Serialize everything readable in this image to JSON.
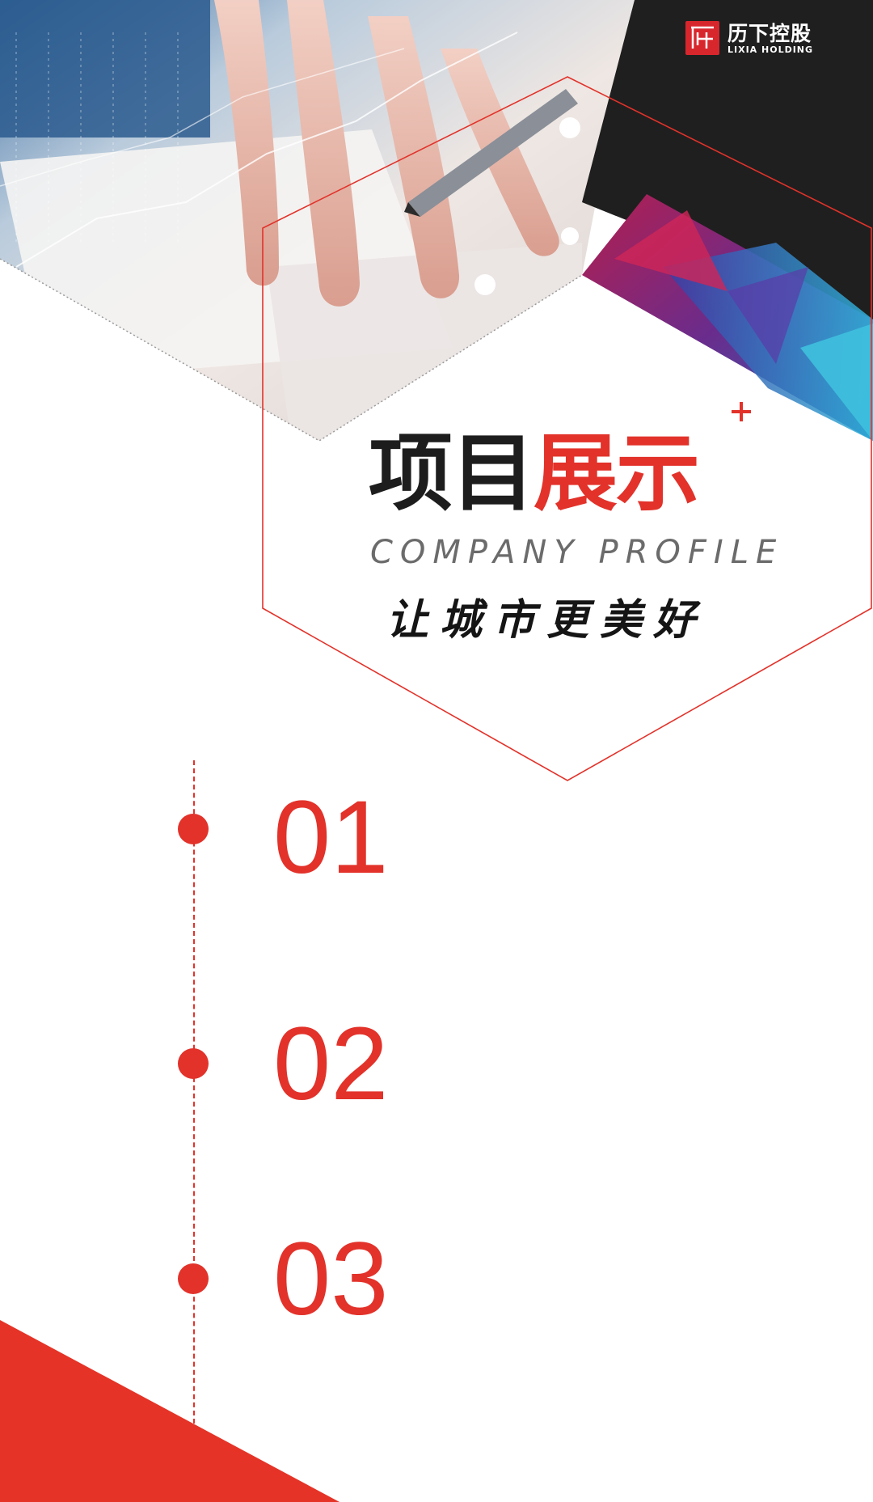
{
  "brand": {
    "name_cn": "历下控股",
    "name_en": "LIXIA HOLDING",
    "logo_icon": "lixia-logo-icon",
    "accent": "#e2322a",
    "dark": "#1d1d1d"
  },
  "hero": {
    "photo": "hand-with-pen-over-documents",
    "title_part1": "项目",
    "title_part2": "展示",
    "subtitle_en": "COMPANY PROFILE",
    "slogan": "让城市更美好",
    "plus_icon": "plus-icon"
  },
  "timeline": {
    "items": [
      {
        "label": "01"
      },
      {
        "label": "02"
      },
      {
        "label": "03"
      }
    ]
  }
}
